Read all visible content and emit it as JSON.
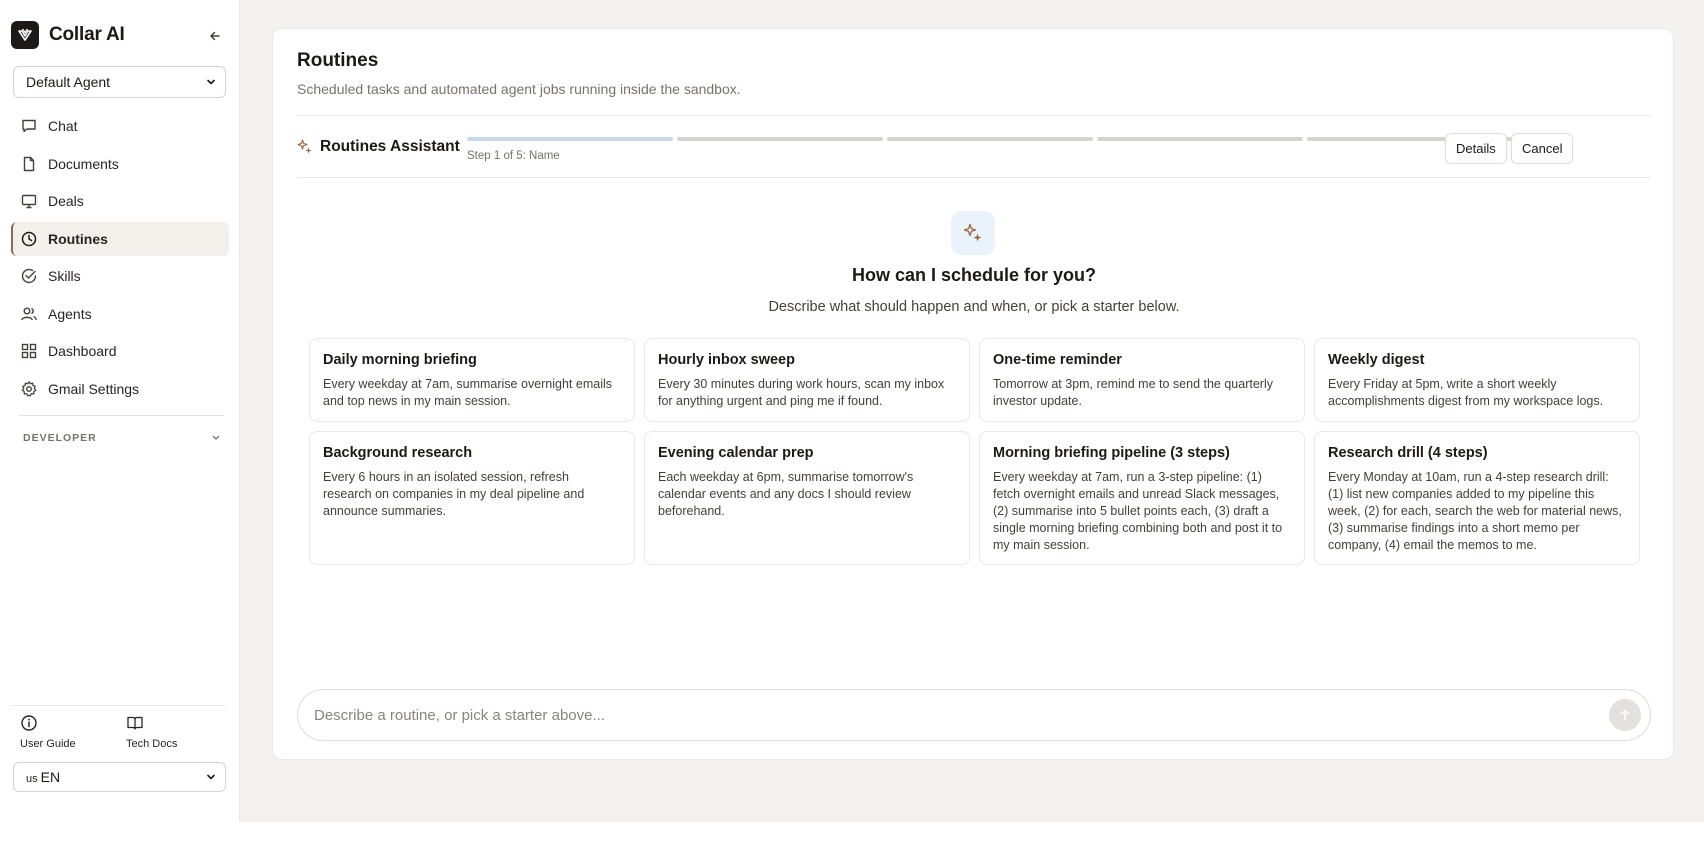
{
  "brand": {
    "name": "Collar AI"
  },
  "agent_select": {
    "value": "Default Agent"
  },
  "nav": {
    "items": [
      {
        "label": "Chat",
        "icon": "chat-icon"
      },
      {
        "label": "Documents",
        "icon": "document-icon"
      },
      {
        "label": "Deals",
        "icon": "monitor-icon"
      },
      {
        "label": "Routines",
        "icon": "clock-icon",
        "active": true
      },
      {
        "label": "Skills",
        "icon": "check-circle-icon"
      },
      {
        "label": "Agents",
        "icon": "users-icon"
      },
      {
        "label": "Dashboard",
        "icon": "grid-icon"
      },
      {
        "label": "Gmail Settings",
        "icon": "gear-icon"
      }
    ]
  },
  "developer": {
    "label": "DEVELOPER"
  },
  "footer": {
    "user_guide": "User Guide",
    "tech_docs": "Tech Docs"
  },
  "language": {
    "flag": "us",
    "value": "EN"
  },
  "page": {
    "title": "Routines",
    "subtitle": "Scheduled tasks and automated agent jobs running inside the sandbox."
  },
  "assistant": {
    "title": "Routines Assistant",
    "step_label": "Step 1 of 5: Name",
    "current_step": 1,
    "total_steps": 5,
    "details_label": "Details",
    "cancel_label": "Cancel"
  },
  "hero": {
    "title": "How can I schedule for you?",
    "subtitle": "Describe what should happen and when, or pick a starter below."
  },
  "starters": [
    {
      "title": "Daily morning briefing",
      "desc": "Every weekday at 7am, summarise overnight emails and top news in my main session."
    },
    {
      "title": "Hourly inbox sweep",
      "desc": "Every 30 minutes during work hours, scan my inbox for anything urgent and ping me if found."
    },
    {
      "title": "One-time reminder",
      "desc": "Tomorrow at 3pm, remind me to send the quarterly investor update."
    },
    {
      "title": "Weekly digest",
      "desc": "Every Friday at 5pm, write a short weekly accomplishments digest from my workspace logs."
    },
    {
      "title": "Background research",
      "desc": "Every 6 hours in an isolated session, refresh research on companies in my deal pipeline and announce summaries."
    },
    {
      "title": "Evening calendar prep",
      "desc": "Each weekday at 6pm, summarise tomorrow's calendar events and any docs I should review beforehand."
    },
    {
      "title": "Morning briefing pipeline (3 steps)",
      "desc": "Every weekday at 7am, run a 3-step pipeline: (1) fetch overnight emails and unread Slack messages, (2) summarise into 5 bullet points each, (3) draft a single morning briefing combining both and post it to my main session."
    },
    {
      "title": "Research drill (4 steps)",
      "desc": "Every Monday at 10am, run a 4-step research drill: (1) list new companies added to my pipeline this week, (2) for each, search the web for material news, (3) summarise findings into a short memo per company, (4) email the memos to me."
    }
  ],
  "composer": {
    "placeholder": "Describe a routine, or pick a starter above..."
  },
  "colors": {
    "accent": "#8a6a50",
    "sparkle": "#a0643c",
    "step_active": "#c9d8ef"
  }
}
